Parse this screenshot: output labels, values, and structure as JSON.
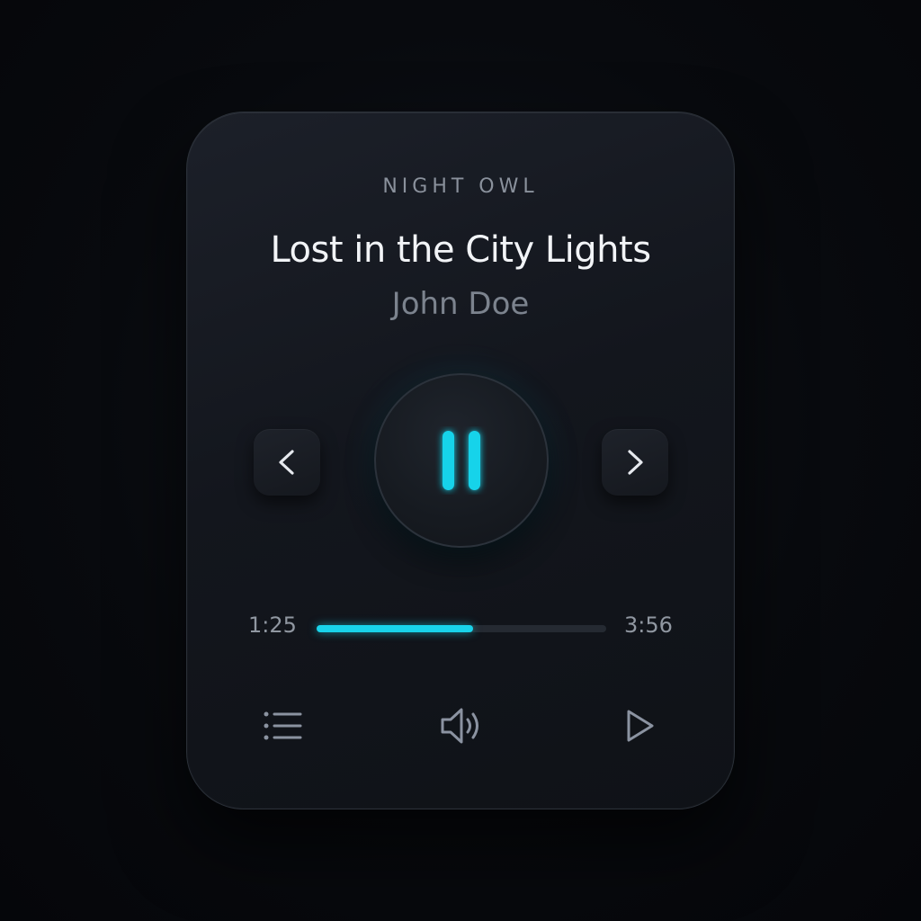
{
  "player": {
    "station": "NIGHT OWL",
    "track_title": "Lost in the City Lights",
    "artist": "John Doe",
    "state": "playing",
    "elapsed": "1:25",
    "duration": "3:56",
    "progress_fraction": 0.54
  },
  "controls": {
    "previous_icon": "chevron-left-icon",
    "pause_icon": "pause-icon",
    "next_icon": "chevron-right-icon",
    "playlist_icon": "playlist-icon",
    "volume_icon": "volume-icon",
    "play_icon": "play-icon"
  },
  "colors": {
    "accent": "#19d3ea",
    "background": "#080a0e",
    "card": "#16191f",
    "text_primary": "#f2f4f7",
    "text_secondary": "#7c838e"
  }
}
